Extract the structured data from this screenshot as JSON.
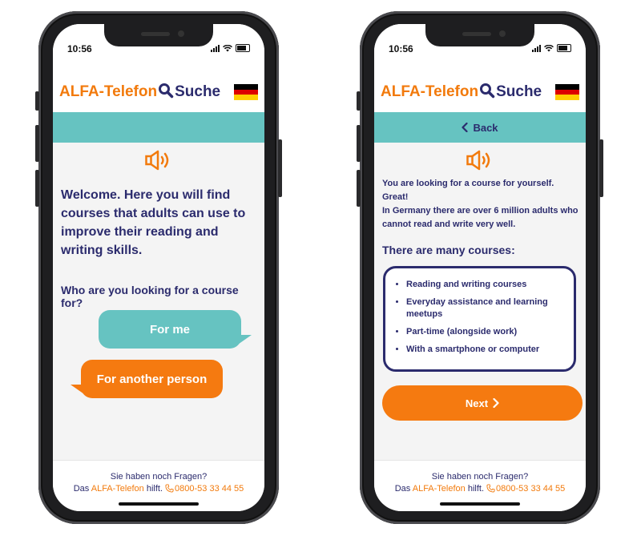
{
  "status_bar": {
    "time": "10:56"
  },
  "header": {
    "logo_left": "ALFA-Telefon",
    "logo_right": "Suche",
    "flag": {
      "colors": [
        "#000000",
        "#dd0000",
        "#ffce00"
      ],
      "country": "Germany"
    }
  },
  "colors": {
    "navy": "#2b2b6d",
    "orange": "#f57a10",
    "teal": "#66c3c1"
  },
  "screen1": {
    "speaker_icon": "speaker-icon",
    "welcome_text": "Welcome. Here you will find courses that adults can use to improve their reading and writing skills.",
    "question": "Who are you looking for a course for?",
    "option_me": "For me",
    "option_other": "For another person"
  },
  "screen2": {
    "back_label": "Back",
    "info_line1": "You are looking for a course for yourself.",
    "info_line2": "Great!",
    "info_line3": "In Germany there are over 6 million adults who cannot read and write very well.",
    "courses_title": "There are many courses:",
    "courses": [
      "Reading and writing courses",
      "Everyday assistance and learning meetups",
      "Part-time (alongside work)",
      "With a smartphone or computer"
    ],
    "next_label": "Next"
  },
  "footer": {
    "question": "Sie haben noch Fragen?",
    "prefix": "Das",
    "brand": "ALFA-Telefon",
    "suffix": "hilft.",
    "phone": "0800-53 33 44 55"
  }
}
